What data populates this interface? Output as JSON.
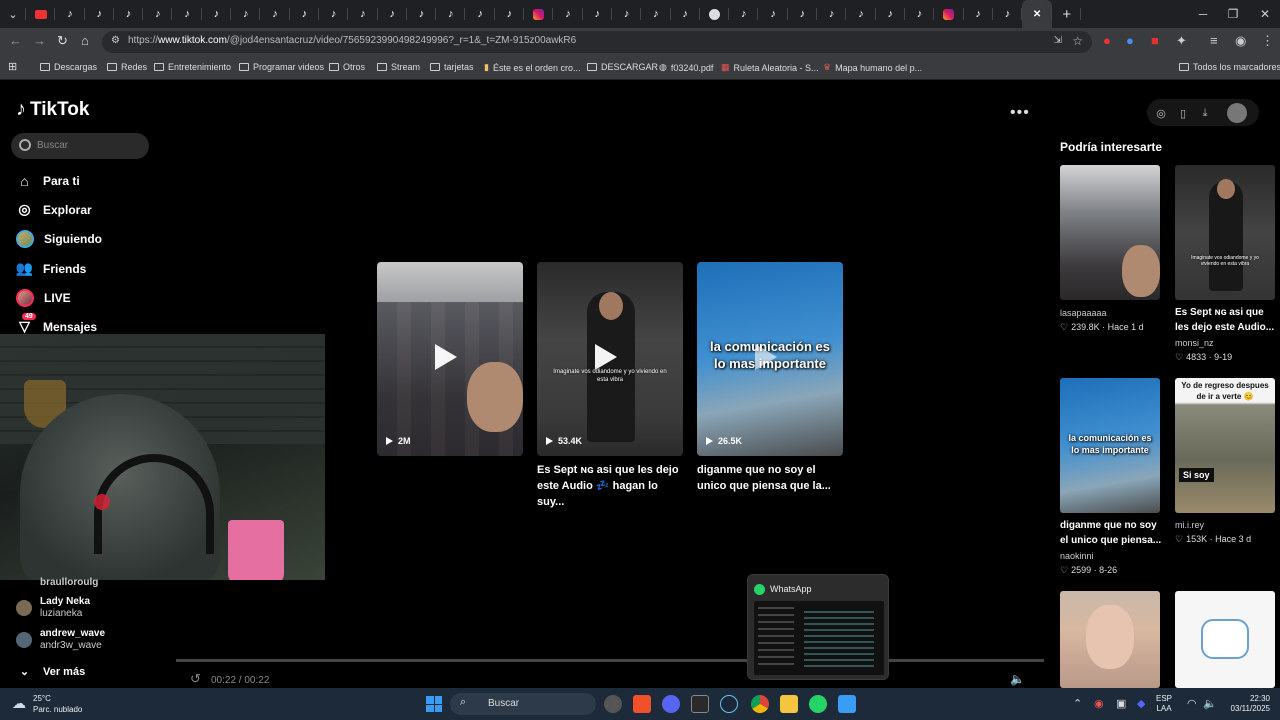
{
  "browser": {
    "url_prefix": "https://",
    "url_host": "www.tiktok.com",
    "url_path": "/@jod4ensantacruz/video/7565923990498249996?_r=1&_t=ZM-915z00awkR6",
    "tab_close": "✕",
    "new_tab": "+"
  },
  "bookmarks": {
    "items": [
      "Descargas",
      "Redes",
      "Entretenimiento",
      "Programar videos",
      "Otros",
      "Stream",
      "tarjetas",
      "Éste es el orden cro...",
      "DESCARGAR",
      "f03240.pdf",
      "Ruleta Aleatoria - S...",
      "Mapa humano del p..."
    ],
    "all": "Todos los marcadores"
  },
  "sidebar": {
    "logo": "TikTok",
    "search_placeholder": "Buscar",
    "nav": [
      {
        "label": "Para ti",
        "icon": "home-icon"
      },
      {
        "label": "Explorar",
        "icon": "compass-icon"
      },
      {
        "label": "Siguiendo",
        "icon": "following-avatar-icon"
      },
      {
        "label": "Friends",
        "icon": "friends-icon"
      },
      {
        "label": "LIVE",
        "icon": "live-icon"
      },
      {
        "label": "Mensajes",
        "icon": "messages-icon",
        "badge": "49"
      }
    ],
    "following_partial": "braulloroulg",
    "following": [
      {
        "name": "Lady Neka",
        "handle": "luzianeka"
      },
      {
        "name": "andrew_wave",
        "handle": "andr3w_wave"
      }
    ],
    "see_more": "Ver más"
  },
  "videos": [
    {
      "views": "2M",
      "title": ""
    },
    {
      "views": "53.4K",
      "title": "Es Sept ɴɢ asi que les dejo este Audio 💤 hagan lo suy...",
      "overlay": "Imaginate vos odiandome y yo viviendo en esta vibra"
    },
    {
      "views": "26.5K",
      "title": "diganme que no soy el unico que piensa que la...",
      "overlay": "la comunicación es lo mas importante"
    }
  ],
  "recommendations": {
    "title": "Podría interesarte",
    "items": [
      {
        "user": "lasapaaaaa",
        "likes": "239.8K",
        "date": "Hace 1 d",
        "title": ""
      },
      {
        "user": "monsi_nz",
        "likes": "4833",
        "date": "9-19",
        "title": "Es Sept ɴɢ asi que les dejo este Audio...",
        "overlay": "Imaginate vos odiandome y yo viviendo en esta vibra"
      },
      {
        "user": "naokinni",
        "likes": "2599",
        "date": "8-26",
        "title": "diganme que no soy el unico que piensa...",
        "overlay": "la comunicación es lo mas importante"
      },
      {
        "user": "mi.i.rey",
        "likes": "153K",
        "date": "Hace 3 d",
        "title": "",
        "overlay_top": "Yo de regreso despues de ir a verte 😊",
        "overlay_mid": "Si soy"
      }
    ]
  },
  "player": {
    "time": "00:22 / 00:22"
  },
  "whatsapp_preview": {
    "title": "WhatsApp"
  },
  "taskbar": {
    "weather_temp": "25°C",
    "weather_desc": "Parc. nublado",
    "search": "Buscar",
    "lang_top": "ESP",
    "lang_bottom": "LAA",
    "time": "22:30",
    "date": "03/11/2025"
  },
  "colors": {
    "accent_whatsapp": "#25d366",
    "tiktok_badge": "#fe2c55",
    "browser_bg": "#1f2023"
  }
}
